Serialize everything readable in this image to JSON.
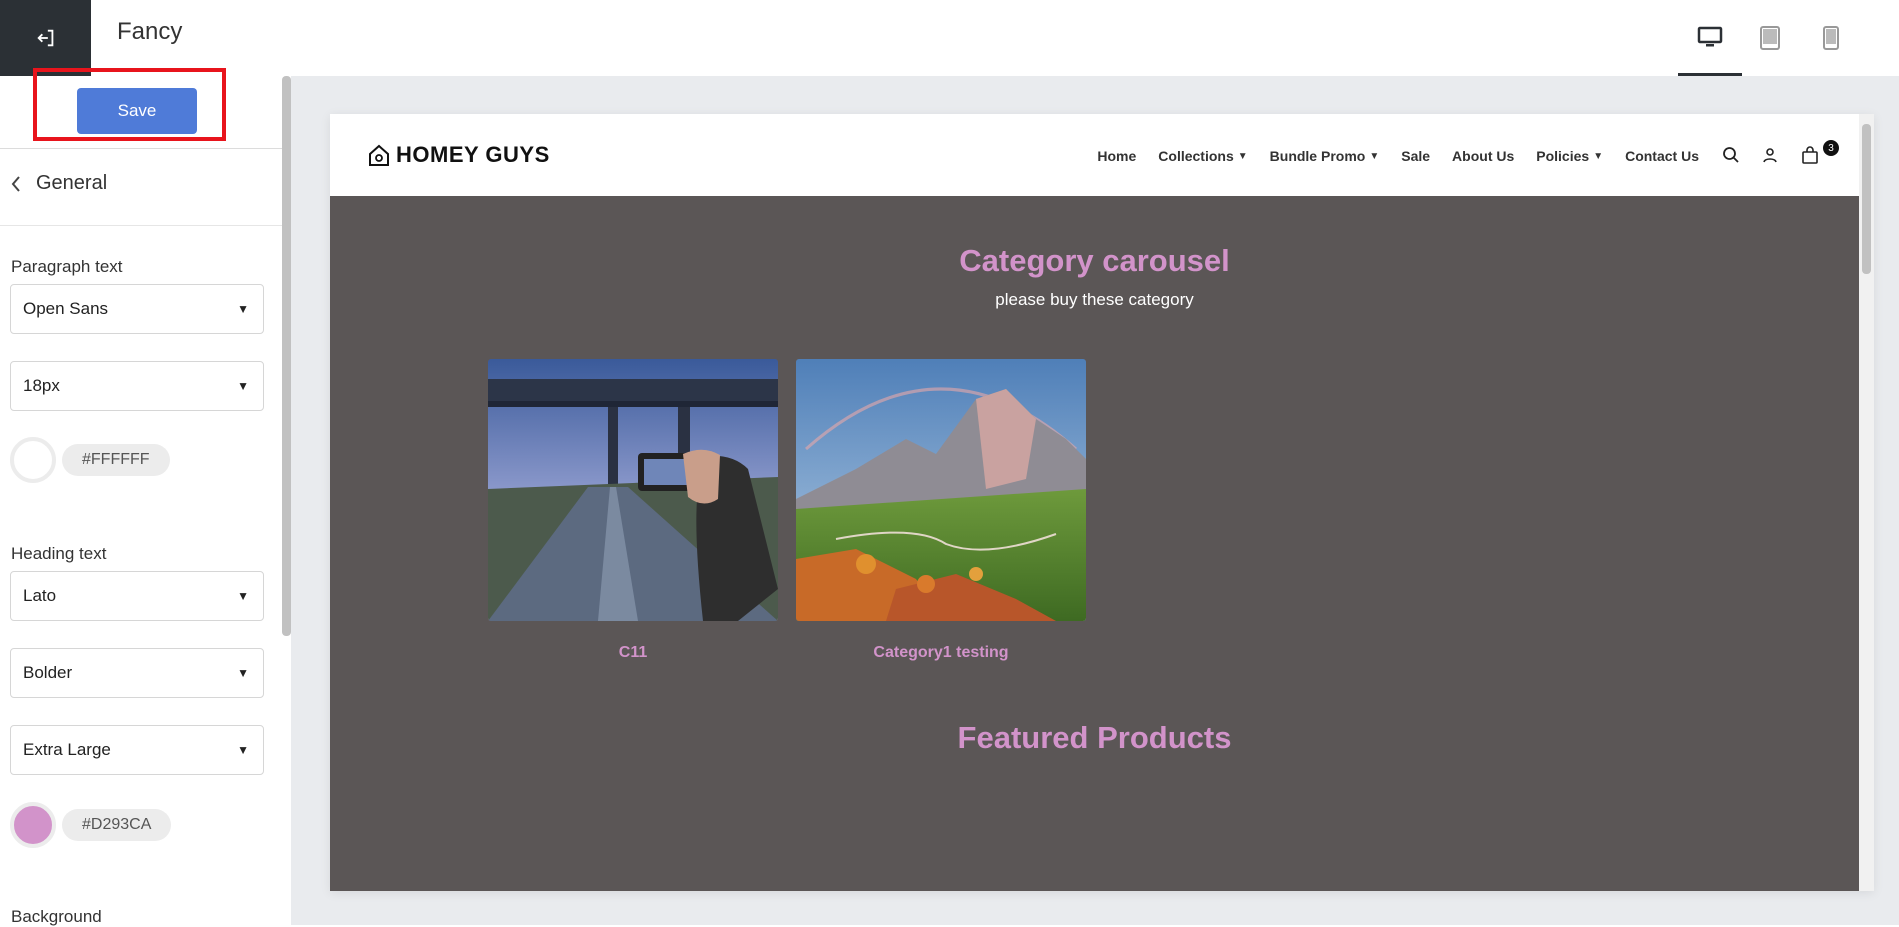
{
  "topbar": {
    "exit_icon": "exit-icon",
    "theme_name": "Fancy",
    "devices": [
      {
        "name": "desktop-icon",
        "active": true
      },
      {
        "name": "tablet-icon",
        "active": false
      },
      {
        "name": "mobile-icon",
        "active": false
      }
    ]
  },
  "panel": {
    "save_label": "Save",
    "section_title": "General",
    "paragraph": {
      "label": "Paragraph text",
      "font": "Open Sans",
      "size": "18px",
      "color_hex": "#FFFFFF",
      "color": "#ffffff"
    },
    "heading": {
      "label": "Heading text",
      "font": "Lato",
      "weight": "Bolder",
      "size": "Extra Large",
      "color_hex": "#D293CA",
      "color": "#d293ca"
    },
    "background_label": "Background"
  },
  "preview": {
    "brand": "HOMEY GUYS",
    "nav": [
      {
        "label": "Home",
        "dropdown": false
      },
      {
        "label": "Collections",
        "dropdown": true
      },
      {
        "label": "Bundle Promo",
        "dropdown": true
      },
      {
        "label": "Sale",
        "dropdown": false
      },
      {
        "label": "About Us",
        "dropdown": false
      },
      {
        "label": "Policies",
        "dropdown": true
      },
      {
        "label": "Contact Us",
        "dropdown": false
      }
    ],
    "cart_count": "3",
    "carousel_title": "Category carousel",
    "carousel_subtitle": "please buy these category",
    "categories": [
      {
        "label": "C11",
        "image": "bridge-photo"
      },
      {
        "label": "Category1 testing",
        "image": "mountain-photo"
      }
    ],
    "featured_title": "Featured Products",
    "bg_color": "#5b5656"
  }
}
